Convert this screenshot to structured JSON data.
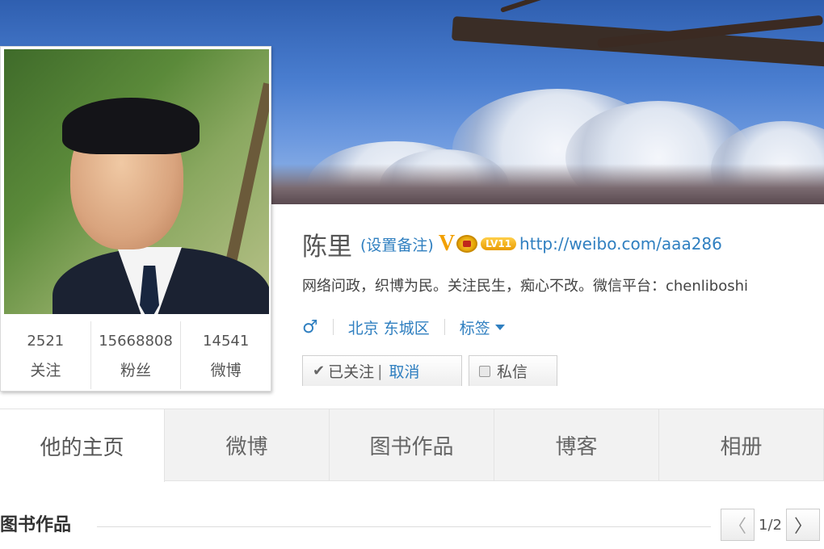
{
  "profile": {
    "name": "陈里",
    "remark_link": "(设置备注)",
    "verified_badge": "V",
    "level_badge": "LV11",
    "homepage_url": "http://weibo.com/aaa286",
    "bio": "网络问政，织博为民。关注民生，痴心不改。微信平台：chenliboshi",
    "gender_symbol": "♂",
    "location": "北京 东城区",
    "tags_label": "标签"
  },
  "stats": [
    {
      "value": "2521",
      "label": "关注"
    },
    {
      "value": "15668808",
      "label": "粉丝"
    },
    {
      "value": "14541",
      "label": "微博"
    }
  ],
  "actions": {
    "followed_label": "已关注",
    "divider": "|",
    "cancel_label": "取消",
    "message_label": "私信"
  },
  "nav": {
    "tabs": [
      {
        "label": "他的主页",
        "active": true
      },
      {
        "label": "微博",
        "active": false
      },
      {
        "label": "图书作品",
        "active": false
      },
      {
        "label": "博客",
        "active": false
      },
      {
        "label": "相册",
        "active": false
      }
    ]
  },
  "section": {
    "title": "图书作品",
    "page_indicator": "1/2",
    "prev_symbol": "〈",
    "next_symbol": "〉"
  },
  "icons": {
    "check": "check-icon",
    "male": "male-icon",
    "crown": "crown-icon",
    "caret": "caret-down-icon",
    "message": "message-icon"
  },
  "colors": {
    "link": "#2f7fc0",
    "badge_gold": "#f2a000"
  }
}
